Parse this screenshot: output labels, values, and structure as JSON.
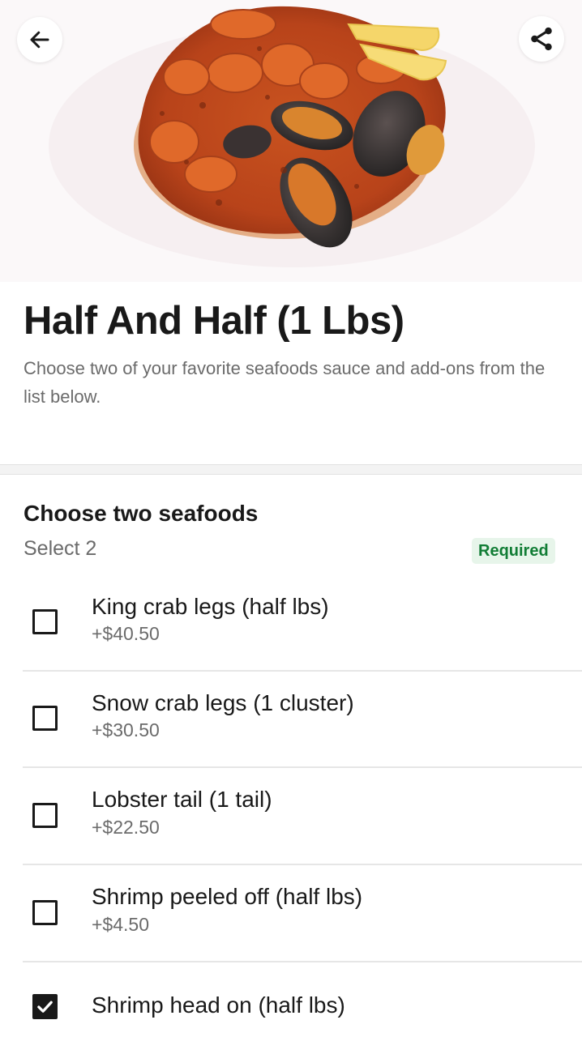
{
  "header": {
    "back_icon": "arrow-left-icon",
    "share_icon": "share-icon"
  },
  "hero": {
    "image": "seafood-boil-photo"
  },
  "item": {
    "title": "Half And Half (1 Lbs)",
    "description": "Choose two of your favorite seafoods sauce and add-ons from the list below."
  },
  "section": {
    "title": "Choose two seafoods",
    "subtitle": "Select 2",
    "badge": "Required",
    "badge_color": "#117d35",
    "options": [
      {
        "label": "King crab legs (half lbs)",
        "price": "+$40.50",
        "checked": false
      },
      {
        "label": "Snow crab legs (1 cluster)",
        "price": "+$30.50",
        "checked": false
      },
      {
        "label": "Lobster tail (1 tail)",
        "price": "+$22.50",
        "checked": false
      },
      {
        "label": "Shrimp peeled off (half lbs)",
        "price": "+$4.50",
        "checked": false
      },
      {
        "label": "Shrimp head on (half lbs)",
        "price": "",
        "checked": true
      }
    ]
  }
}
